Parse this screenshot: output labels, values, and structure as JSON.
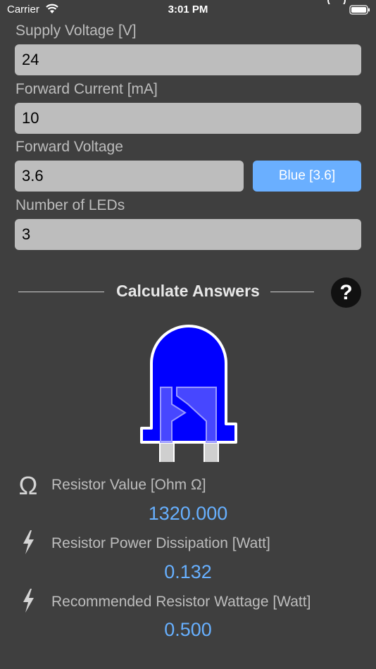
{
  "status_bar": {
    "carrier": "Carrier",
    "time": "3:01 PM"
  },
  "inputs": {
    "supply_voltage": {
      "label": "Supply Voltage [V]",
      "value": "24"
    },
    "forward_current": {
      "label": "Forward Current [mA]",
      "value": "10"
    },
    "forward_voltage": {
      "label": "Forward Voltage",
      "value": "3.6",
      "color_button": "Blue [3.6]"
    },
    "number_of_leds": {
      "label": "Number of LEDs",
      "value": "3"
    }
  },
  "calculate": {
    "title": "Calculate Answers",
    "help": "?"
  },
  "led": {
    "color": "#0000ff"
  },
  "results": {
    "resistor_value": {
      "icon": "Ω",
      "label": "Resistor Value [Ohm Ω]",
      "value": "1320.000"
    },
    "power_dissipation": {
      "icon": "lightning-icon",
      "label": "Resistor Power Dissipation [Watt]",
      "value": "0.132"
    },
    "recommended_wattage": {
      "icon": "lightning-icon",
      "label": "Recommended Resistor Wattage [Watt]",
      "value": "0.500"
    }
  }
}
